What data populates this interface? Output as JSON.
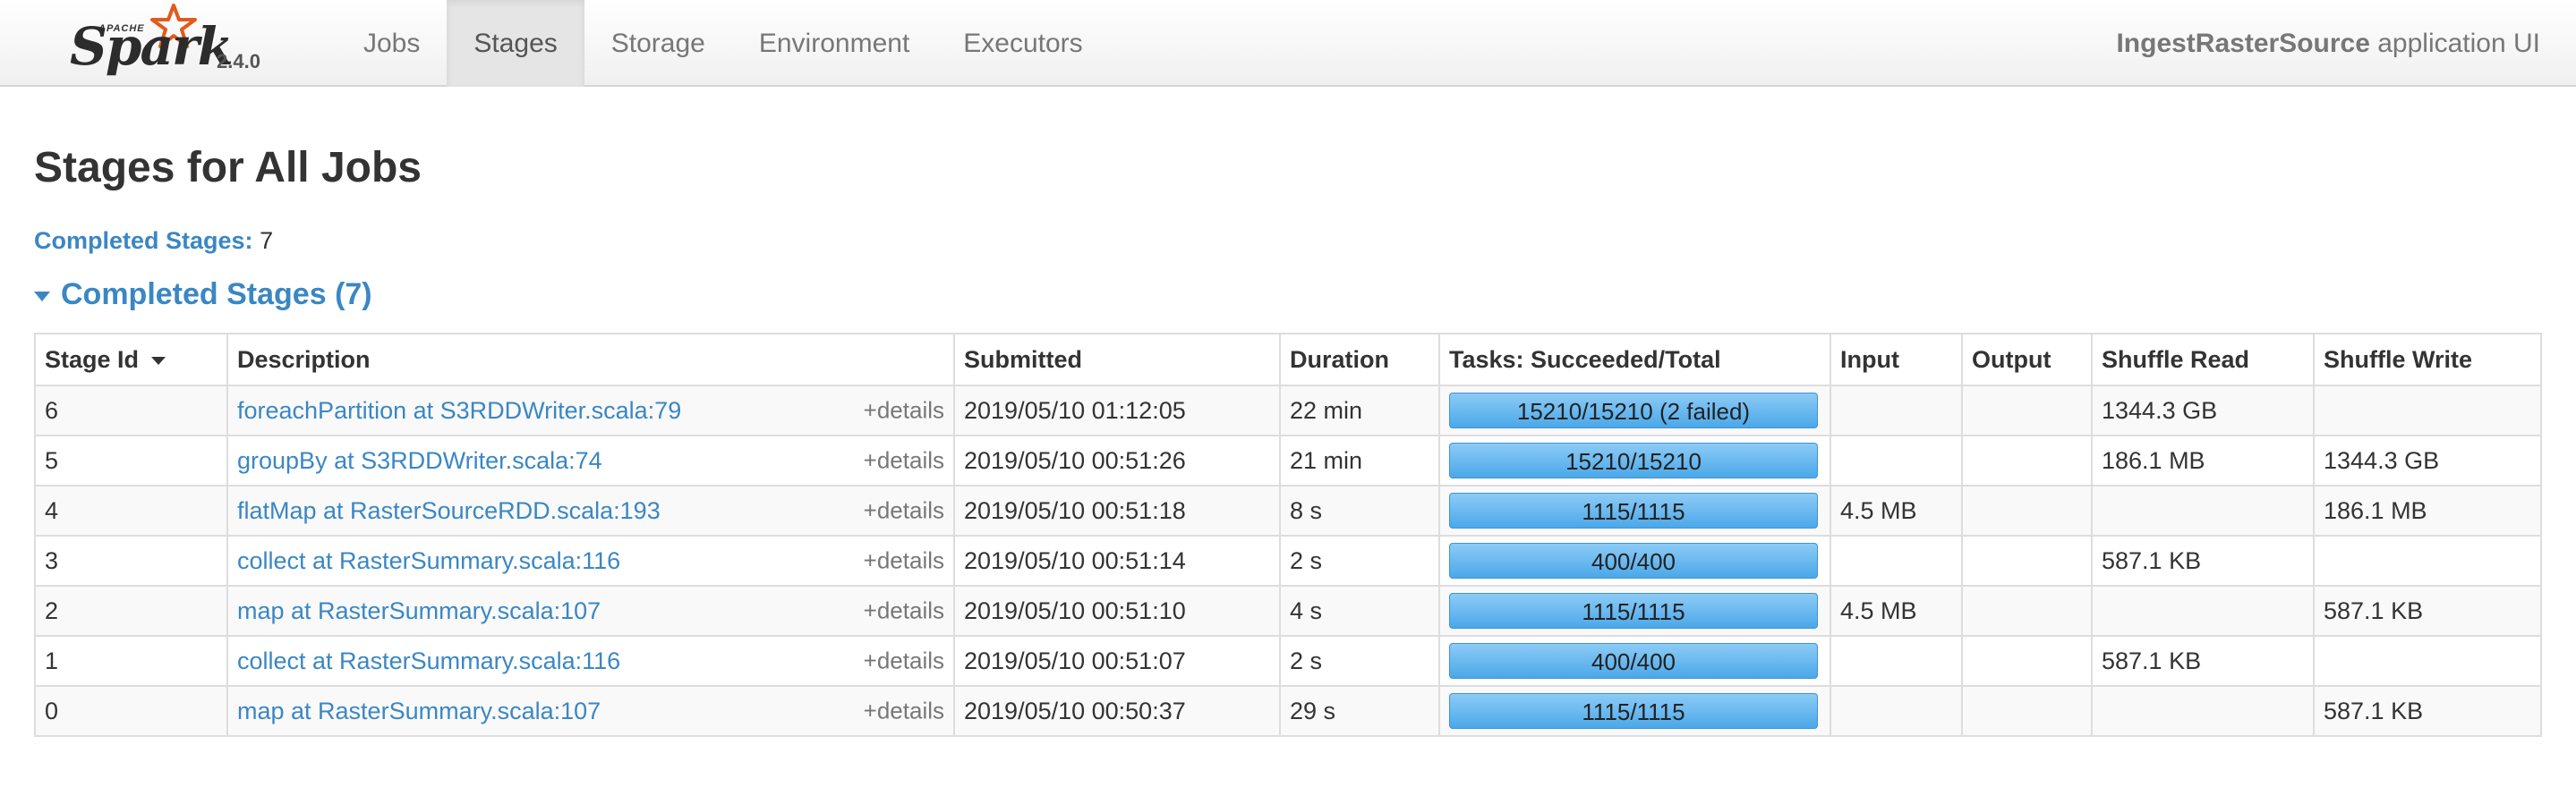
{
  "brand": {
    "apache": "APACHE",
    "name": "Spark",
    "version": "2.4.0"
  },
  "nav": {
    "tabs": [
      {
        "label": "Jobs",
        "active": false
      },
      {
        "label": "Stages",
        "active": true
      },
      {
        "label": "Storage",
        "active": false
      },
      {
        "label": "Environment",
        "active": false
      },
      {
        "label": "Executors",
        "active": false
      }
    ],
    "app_name": "IngestRasterSource",
    "app_suffix": " application UI"
  },
  "page": {
    "title": "Stages for All Jobs",
    "summary_label": "Completed Stages:",
    "summary_value": "7",
    "section_title": "Completed Stages (7)"
  },
  "table": {
    "headers": {
      "stage_id": "Stage Id",
      "description": "Description",
      "submitted": "Submitted",
      "duration": "Duration",
      "tasks": "Tasks: Succeeded/Total",
      "input": "Input",
      "output": "Output",
      "shuffle_read": "Shuffle Read",
      "shuffle_write": "Shuffle Write"
    },
    "details_label": "+details",
    "rows": [
      {
        "id": "6",
        "desc": "foreachPartition at S3RDDWriter.scala:79",
        "submitted": "2019/05/10 01:12:05",
        "duration": "22 min",
        "tasks": "15210/15210 (2 failed)",
        "progress": 1.0,
        "input": "",
        "output": "",
        "shuffle_read": "1344.3 GB",
        "shuffle_write": ""
      },
      {
        "id": "5",
        "desc": "groupBy at S3RDDWriter.scala:74",
        "submitted": "2019/05/10 00:51:26",
        "duration": "21 min",
        "tasks": "15210/15210",
        "progress": 1.0,
        "input": "",
        "output": "",
        "shuffle_read": "186.1 MB",
        "shuffle_write": "1344.3 GB"
      },
      {
        "id": "4",
        "desc": "flatMap at RasterSourceRDD.scala:193",
        "submitted": "2019/05/10 00:51:18",
        "duration": "8 s",
        "tasks": "1115/1115",
        "progress": 1.0,
        "input": "4.5 MB",
        "output": "",
        "shuffle_read": "",
        "shuffle_write": "186.1 MB"
      },
      {
        "id": "3",
        "desc": "collect at RasterSummary.scala:116",
        "submitted": "2019/05/10 00:51:14",
        "duration": "2 s",
        "tasks": "400/400",
        "progress": 1.0,
        "input": "",
        "output": "",
        "shuffle_read": "587.1 KB",
        "shuffle_write": ""
      },
      {
        "id": "2",
        "desc": "map at RasterSummary.scala:107",
        "submitted": "2019/05/10 00:51:10",
        "duration": "4 s",
        "tasks": "1115/1115",
        "progress": 1.0,
        "input": "4.5 MB",
        "output": "",
        "shuffle_read": "",
        "shuffle_write": "587.1 KB"
      },
      {
        "id": "1",
        "desc": "collect at RasterSummary.scala:116",
        "submitted": "2019/05/10 00:51:07",
        "duration": "2 s",
        "tasks": "400/400",
        "progress": 1.0,
        "input": "",
        "output": "",
        "shuffle_read": "587.1 KB",
        "shuffle_write": ""
      },
      {
        "id": "0",
        "desc": "map at RasterSummary.scala:107",
        "submitted": "2019/05/10 00:50:37",
        "duration": "29 s",
        "tasks": "1115/1115",
        "progress": 1.0,
        "input": "",
        "output": "",
        "shuffle_read": "",
        "shuffle_write": "587.1 KB"
      }
    ]
  }
}
